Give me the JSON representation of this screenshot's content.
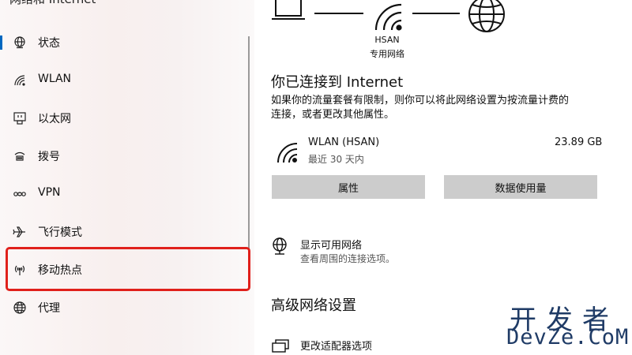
{
  "sidebar": {
    "title": "网络和 Internet",
    "items": [
      {
        "label": "状态",
        "icon": "globe-home-icon"
      },
      {
        "label": "WLAN",
        "icon": "wifi-icon"
      },
      {
        "label": "以太网",
        "icon": "ethernet-icon"
      },
      {
        "label": "拨号",
        "icon": "dialup-icon"
      },
      {
        "label": "VPN",
        "icon": "vpn-icon"
      },
      {
        "label": "飞行模式",
        "icon": "airplane-icon"
      },
      {
        "label": "移动热点",
        "icon": "hotspot-icon"
      },
      {
        "label": "代理",
        "icon": "globe-icon"
      }
    ],
    "highlight_color": "#e0201b",
    "accent": "#0067c0"
  },
  "diagram": {
    "network_name": "HSAN",
    "network_type": "专用网络"
  },
  "status": {
    "heading": "你已连接到 Internet",
    "description_line1": "如果你的流量套餐有限制，则你可以将此网络设置为按流量计费的",
    "description_line2": "连接，或者更改其他属性。",
    "connection": {
      "name": "WLAN (HSAN)",
      "period": "最近 30 天内",
      "usage": "23.89 GB"
    },
    "buttons": {
      "properties": "属性",
      "data_usage": "数据使用量"
    }
  },
  "show_networks": {
    "title": "显示可用网络",
    "subtitle": "查看周围的连接选项。"
  },
  "advanced": {
    "heading": "高级网络设置",
    "adapter_title": "更改适配器选项"
  },
  "watermark": {
    "top": "开发者",
    "bottom": "DevZe.CoM"
  }
}
